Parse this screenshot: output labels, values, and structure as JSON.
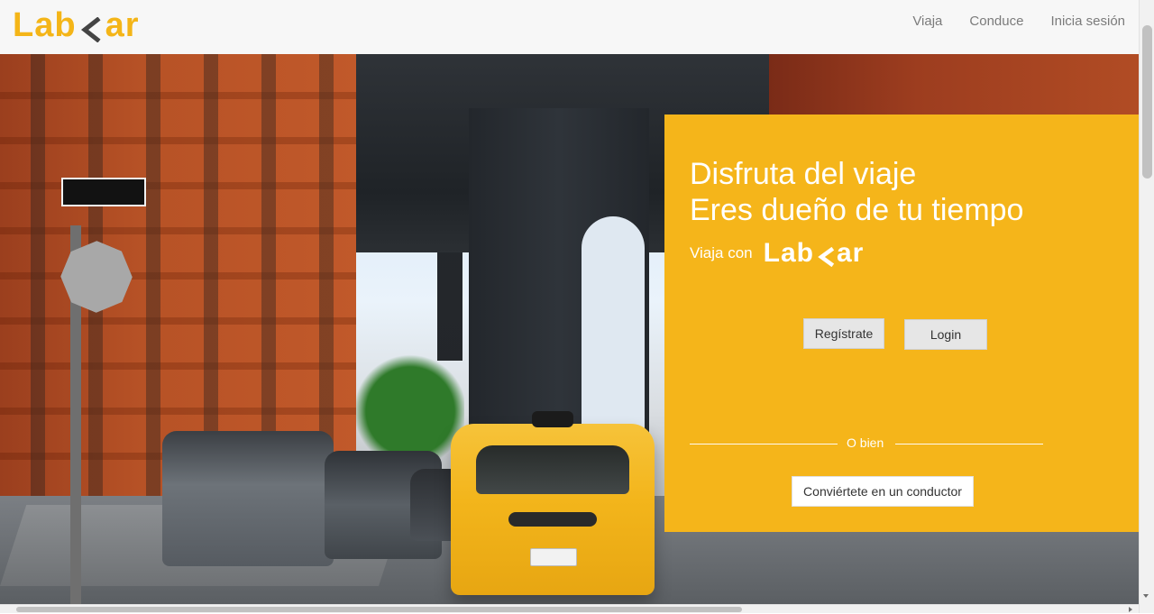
{
  "header": {
    "brand": {
      "left": "Lab",
      "right": "ar",
      "mark_icon": "chevron-left-mark-icon"
    },
    "nav": [
      {
        "label": "Viaja"
      },
      {
        "label": "Conduce"
      },
      {
        "label": "Inicia sesión"
      }
    ]
  },
  "hero_card": {
    "title_line1": "Disfruta del viaje",
    "title_line2": "Eres dueño de tu tiempo",
    "with_label": "Viaja con",
    "logo": {
      "left": "Lab",
      "right": "ar",
      "mark_icon": "chevron-left-mark-icon"
    },
    "buttons": {
      "register": "Regístrate",
      "login": "Login"
    },
    "divider_text": "O bien",
    "driver_button": "Conviértete en un conductor"
  },
  "colors": {
    "brand_yellow": "#f5b51a",
    "text_white": "#ffffff",
    "nav_gray": "#7b7b7b"
  }
}
